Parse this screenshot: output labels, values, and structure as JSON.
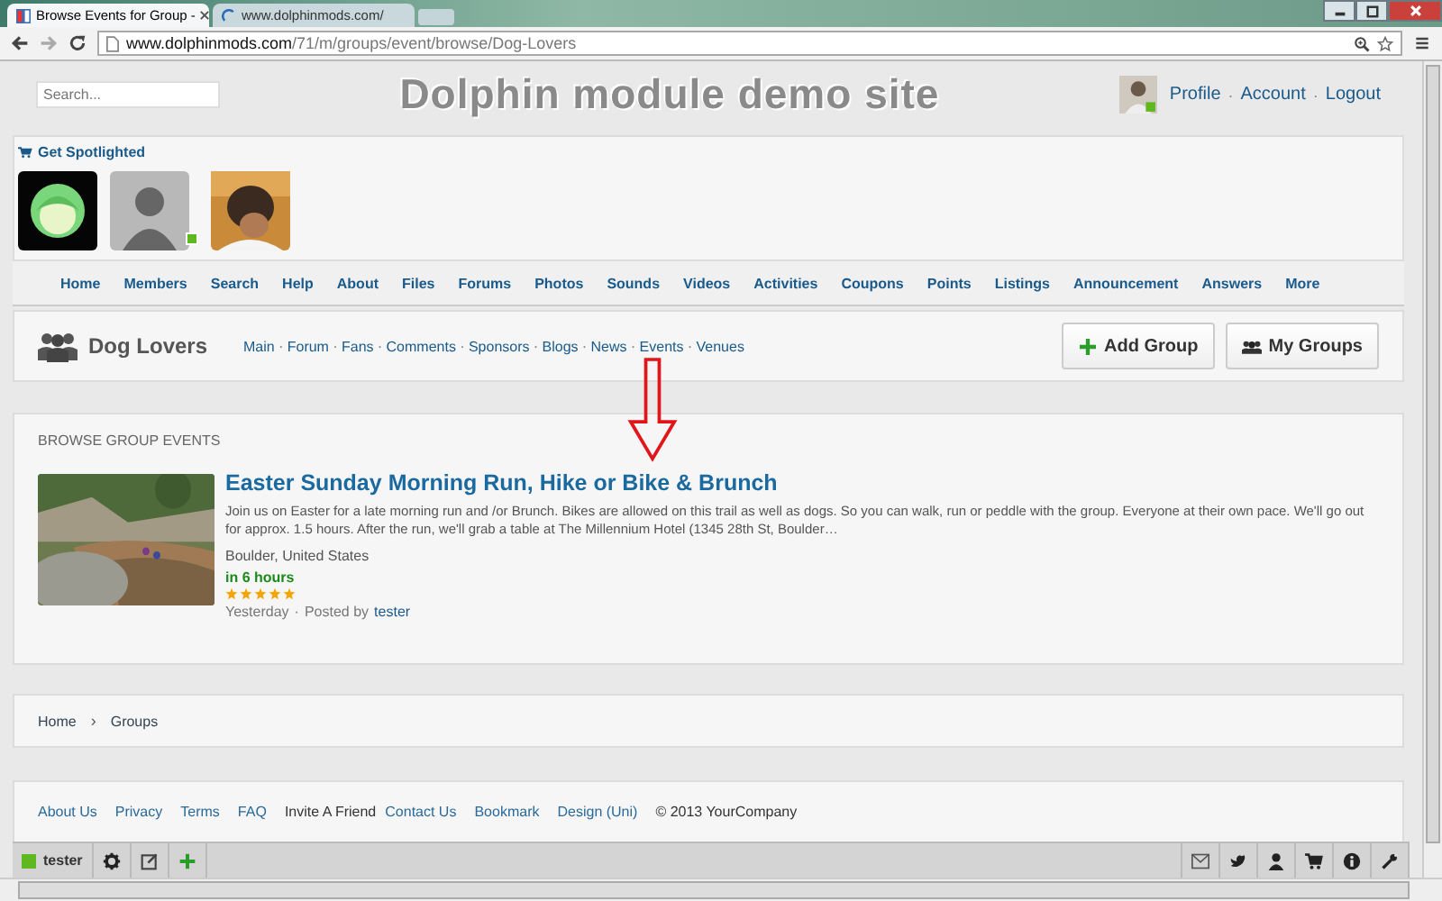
{
  "browser": {
    "tabs": [
      {
        "title": "Browse Events for Group -",
        "selected": true
      },
      {
        "title": "www.dolphinmods.com/",
        "selected": false
      }
    ],
    "url_host": "www.dolphinmods.com",
    "url_path": "/71/m/groups/event/browse/Dog-Lovers"
  },
  "header": {
    "search": {
      "placeholder": "Search..."
    },
    "site_title": "Dolphin module demo site",
    "user_links": [
      "Profile",
      "Account",
      "Logout"
    ],
    "separator": "·"
  },
  "spotlight": {
    "label": "Get Spotlighted",
    "avatars": [
      {
        "kind": "cartoon",
        "online": false
      },
      {
        "kind": "silhouette",
        "online": true
      },
      {
        "kind": "picture",
        "online": false
      }
    ]
  },
  "nav": [
    "Home",
    "Members",
    "Search",
    "Help",
    "About",
    "Files",
    "Forums",
    "Photos",
    "Sounds",
    "Videos",
    "Activities",
    "Coupons",
    "Points",
    "Listings",
    "Announcement",
    "Answers",
    "More"
  ],
  "group": {
    "name": "Dog Lovers",
    "links": [
      "Main",
      "Forum",
      "Fans",
      "Comments",
      "Sponsors",
      "Blogs",
      "News",
      "Events",
      "Venues"
    ],
    "separator": "·",
    "buttons": [
      {
        "kind": "add",
        "label": "Add Group"
      },
      {
        "kind": "groups",
        "label": "My Groups"
      }
    ]
  },
  "events": {
    "heading": "BROWSE GROUP EVENTS",
    "items": [
      {
        "title": "Easter Sunday Morning Run, Hike or Bike & Brunch",
        "description": "Join us on Easter for a late morning run and /or Brunch. Bikes are allowed on this trail as well as dogs. So you can walk, run or peddle with the group. Everyone at their own pace. We'll go out for approx. 1.5 hours. After the run, we'll grab a table at The Millennium Hotel (1345 28th St, Boulder…",
        "location": "Boulder, United States",
        "time": "in 6 hours",
        "stars": 5,
        "date": "Yesterday",
        "separator": "·",
        "posted_by": "Posted by",
        "author": "tester"
      }
    ]
  },
  "breadcrumb": {
    "items": [
      "Home",
      "Groups"
    ],
    "separator": "›"
  },
  "footer": [
    {
      "kind": "link",
      "text": "About Us"
    },
    {
      "kind": "link",
      "text": "Privacy"
    },
    {
      "kind": "link",
      "text": "Terms"
    },
    {
      "kind": "link",
      "text": "FAQ"
    },
    {
      "kind": "text",
      "text": "Invite A Friend"
    },
    {
      "kind": "link",
      "text": "Contact Us"
    },
    {
      "kind": "link",
      "text": "Bookmark"
    },
    {
      "kind": "link",
      "text": "Design (Uni)"
    },
    {
      "kind": "text",
      "text": "© 2013 YourCompany"
    }
  ],
  "toolbar": {
    "user": "tester",
    "online": true
  }
}
